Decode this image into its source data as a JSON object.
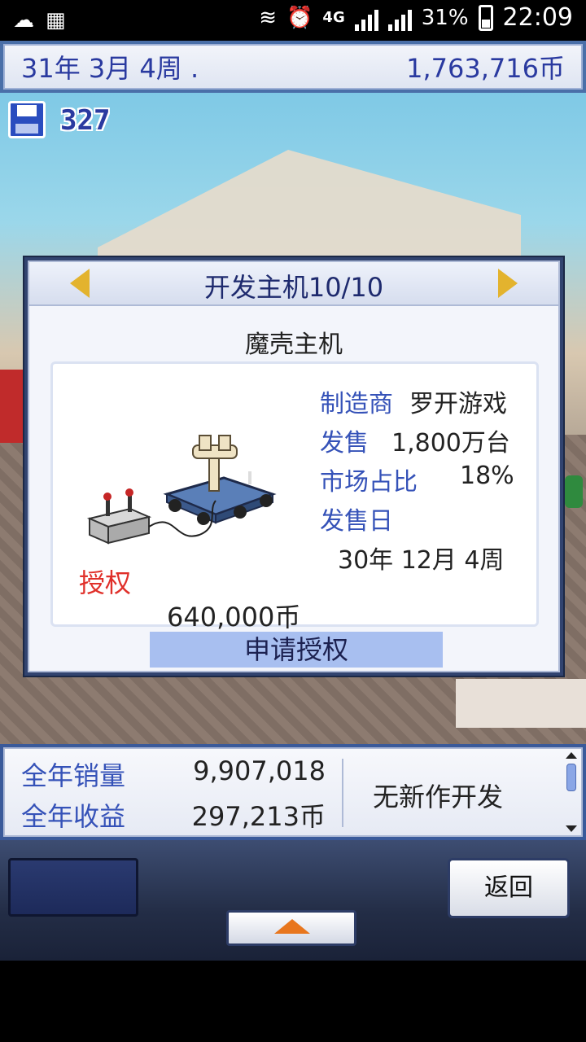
{
  "status_bar": {
    "network": "4G",
    "network2": "4G",
    "network3": "2G",
    "battery": "31%",
    "time": "22:09",
    "icons": [
      "weather-cloud-icon",
      "calendar-icon",
      "vibrate-icon",
      "alarm-icon",
      "signal-icon",
      "battery-icon"
    ]
  },
  "topbar": {
    "date": "31年 3月 4周 .",
    "money": "1,763,716币"
  },
  "research_points": "327",
  "dialog": {
    "title": "开发主机10/10",
    "console_name": "魔壳主机",
    "maker_label": "制造商",
    "maker_value": "罗开游戏",
    "sales_label": "发售",
    "sales_value": "1,800万台",
    "share_label": "市场占比",
    "share_value": "18%",
    "release_label": "发售日",
    "release_value": "30年 12月 4周",
    "license_label": "授权",
    "license_price": "640,000币",
    "apply_button": "申请授权"
  },
  "stats": {
    "annual_sales_label": "全年销量",
    "annual_sales_value": "9,907,018",
    "annual_revenue_label": "全年收益",
    "annual_revenue_value": "297,213币",
    "dev_status": "无新作开发"
  },
  "controls": {
    "back_button": "返回"
  },
  "colors": {
    "accent_blue": "#3552b8",
    "license_red": "#e0302a",
    "apply_button_bg": "#a8bff0",
    "arrow_gold": "#e3b32e"
  }
}
